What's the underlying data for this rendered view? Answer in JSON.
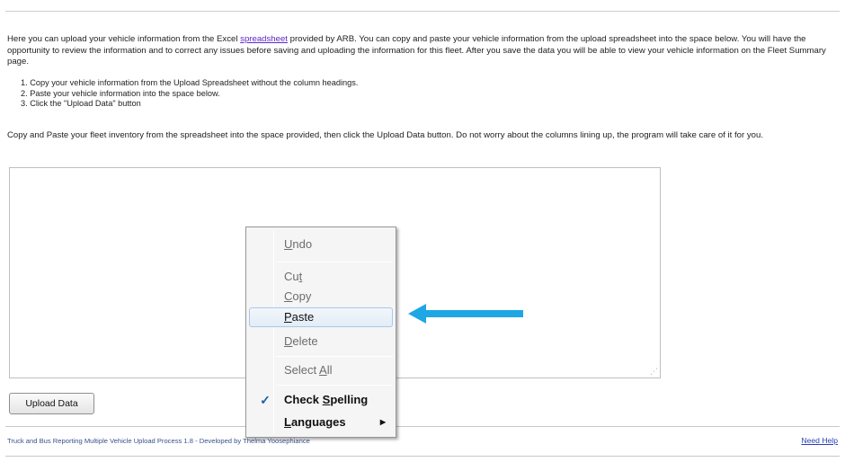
{
  "intro": {
    "text_before_link": "Here you can upload your vehicle information from the Excel ",
    "link": "spreadsheet",
    "text_after_link": " provided by ARB. You can copy and paste your vehicle information from the upload spreadsheet into the space below. You will have the opportunity to review the information and to correct any issues before saving and uploading the information for this fleet. After you save the data you will be able to view your vehicle information on the Fleet Summary page."
  },
  "steps": [
    "1.  Copy your vehicle information from the Upload Spreadsheet without the column headings.",
    "2.  Paste your vehicle information into the space below.",
    "3.  Click the \"Upload Data\" button"
  ],
  "instruction": "Copy and Paste your fleet inventory from the spreadsheet into the space provided, then click the Upload Data button. Do not worry about the columns lining up, the program will take care of it for you.",
  "upload_button": "Upload Data",
  "footer": {
    "left": "Truck and Bus Reporting Multiple Vehicle Upload Process 1.8 - Developed by Thelma Yoosephiance",
    "right": "Need Help"
  },
  "context_menu": {
    "items": [
      {
        "pre": "",
        "key": "U",
        "post": "ndo",
        "enabled": false
      },
      {
        "pre": "Cu",
        "key": "t",
        "post": "",
        "enabled": false
      },
      {
        "pre": "",
        "key": "C",
        "post": "opy",
        "enabled": false
      },
      {
        "pre": "",
        "key": "P",
        "post": "aste",
        "enabled": true,
        "highlighted": true
      },
      {
        "pre": "",
        "key": "D",
        "post": "elete",
        "enabled": false
      },
      {
        "pre": "Select ",
        "key": "A",
        "post": "ll",
        "enabled": false
      },
      {
        "pre": "Check ",
        "key": "S",
        "post": "pelling",
        "enabled": true,
        "checked": true
      },
      {
        "pre": "",
        "key": "L",
        "post": "anguages",
        "enabled": true,
        "submenu": true
      }
    ],
    "check_glyph": "✓",
    "submenu_glyph": "▶"
  },
  "textarea": {
    "value": "",
    "resize_glyph": "⋰"
  },
  "colors": {
    "link": "#5b2ac9",
    "annotation_arrow": "#1ea7e4",
    "menu_highlight_border": "#a8c8e8"
  },
  "icons": {
    "annotation": "arrow-left-icon",
    "check": "check-icon",
    "submenu": "chevron-right-icon"
  }
}
